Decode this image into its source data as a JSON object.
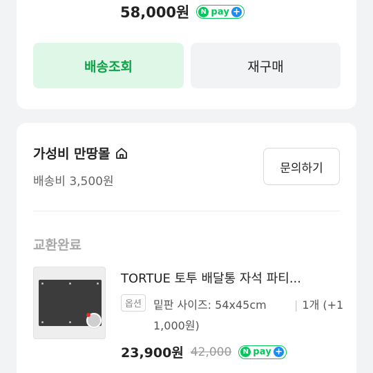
{
  "order1": {
    "price": "58,000원",
    "npay_n": "N",
    "npay_text": "pay",
    "npay_plus": "+",
    "track_button": "배송조회",
    "reorder_button": "재구매"
  },
  "order2": {
    "store_name": "가성비 만땅몰",
    "shipping_fee": "배송비 3,500원",
    "inquiry_button": "문의하기",
    "status": "교환완료",
    "product_name": "TORTUE 토투 배달통 자석 파티...",
    "option_badge": "옵션",
    "option_text": "밑판 사이즈: 54x45cm",
    "quantity": "1개 (+1",
    "quantity_extra": "1,000원)",
    "price": "23,900원",
    "original_price": "42,000",
    "npay_n": "N",
    "npay_text": "pay",
    "npay_plus": "+"
  },
  "colors": {
    "accent_green": "#03c75a",
    "track_bg": "#dff7e7",
    "track_text": "#0da245",
    "npay_plus": "#1b8cf2"
  },
  "icons": {
    "store": "home-icon",
    "npay": "npay-logo"
  }
}
